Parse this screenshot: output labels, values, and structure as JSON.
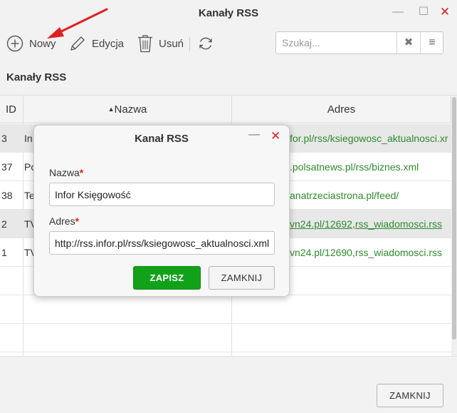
{
  "window": {
    "title": "Kanały RSS"
  },
  "toolbar": {
    "new_label": "Nowy",
    "edit_label": "Edycja",
    "delete_label": "Usuń"
  },
  "search": {
    "placeholder": "Szukaj..."
  },
  "section": {
    "title": "Kanały RSS"
  },
  "grid": {
    "columns": {
      "id": "ID",
      "name": "Nazwa",
      "address": "Adres"
    },
    "sort_indicator": "▲",
    "rows": [
      {
        "id": "3",
        "name": "In",
        "address": "for.pl/rss/ksiegowosc_aktualnosci.xr",
        "selected": true
      },
      {
        "id": "37",
        "name": "Po",
        "address": ".polsatnews.pl/rss/biznes.xml",
        "selected": false
      },
      {
        "id": "38",
        "name": "Te",
        "address": "anatrzeciastrona.pl/feed/",
        "selected": false
      },
      {
        "id": "2",
        "name": "TV",
        "address": "vn24.pl/12692,rss_wiadomosci.rss",
        "selected": true
      },
      {
        "id": "1",
        "name": "TV",
        "address": "vn24.pl/12690,rss_wiadomosci.rss",
        "selected": false
      }
    ]
  },
  "dialog": {
    "title": "Kanał RSS",
    "name_label": "Nazwa",
    "name_value": "Infor Księgowość",
    "address_label": "Adres",
    "address_value": "http://rss.infor.pl/rss/ksiegowosc_aktualnosci.xml",
    "required_mark": "*",
    "save_label": "ZAPISZ",
    "close_label": "ZAMKNIJ"
  },
  "footer": {
    "close_label": "ZAMKNIJ"
  },
  "colors": {
    "accent_green": "#12a21a",
    "link_green": "#2f8a2f",
    "close_red": "#e02020",
    "annotation_arrow": "#e02020"
  },
  "icons": [
    "plus-circle-icon",
    "pencil-icon",
    "trash-icon",
    "refresh-icon",
    "clear-icon",
    "menu-icon",
    "minimize-icon",
    "maximize-icon",
    "close-icon"
  ]
}
